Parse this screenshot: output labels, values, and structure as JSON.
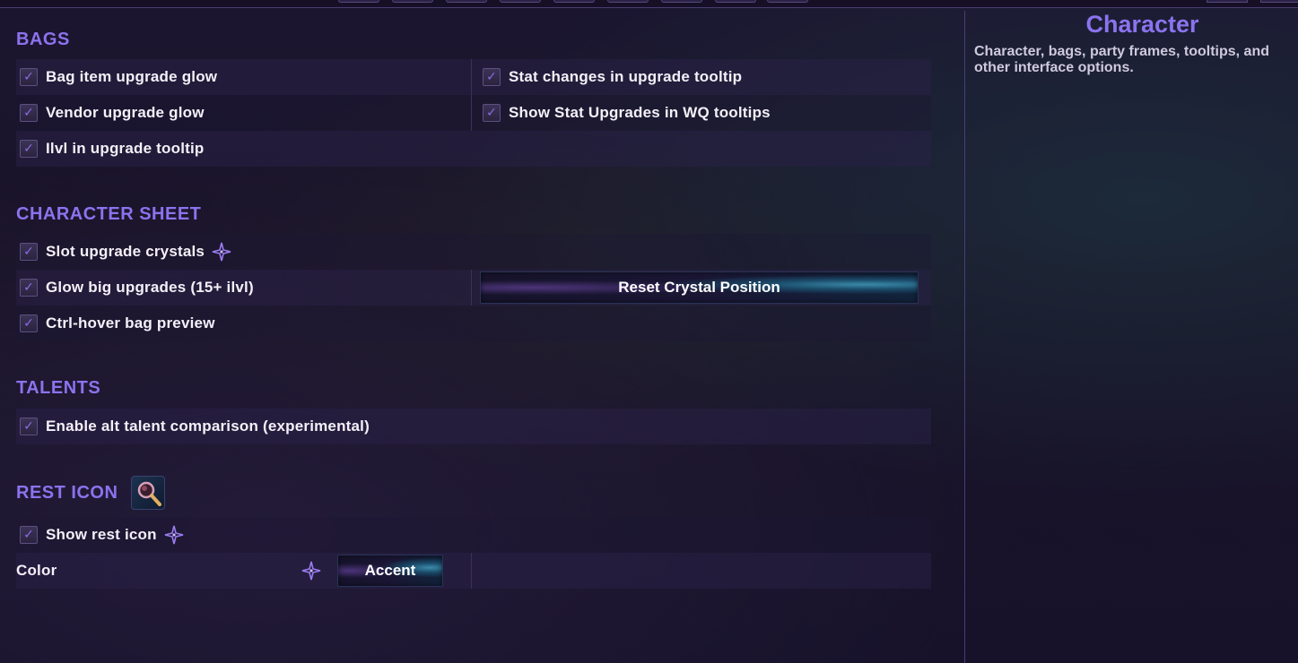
{
  "accent_color": "#8b73ee",
  "main": {
    "sections": {
      "bags": {
        "title": "BAGS",
        "items": {
          "bag_item_upgrade_glow": "Bag item upgrade glow",
          "stat_changes_upgrade_tooltip": "Stat changes in upgrade tooltip",
          "vendor_upgrade_glow": "Vendor upgrade glow",
          "show_stat_upgrades_wq": "Show Stat Upgrades in WQ tooltips",
          "ilvl_upgrade_tooltip": "Ilvl in upgrade tooltip"
        }
      },
      "character_sheet": {
        "title": "CHARACTER SHEET",
        "items": {
          "slot_upgrade_crystals": "Slot upgrade crystals",
          "glow_big_upgrades": "Glow big upgrades (15+ ilvl)",
          "ctrl_hover_bag_preview": "Ctrl-hover bag preview"
        },
        "reset_button": "Reset Crystal Position"
      },
      "talents": {
        "title": "TALENTS",
        "items": {
          "enable_alt_talent": "Enable alt talent comparison (experimental)"
        }
      },
      "rest_icon": {
        "title": "REST ICON",
        "items": {
          "show_rest_icon": "Show rest icon"
        },
        "color_label": "Color",
        "color_button": "Accent"
      }
    },
    "checkbox_mark": "✓"
  },
  "sidebar": {
    "title": "Character",
    "description": "Character, bags, party frames, tooltips, and other interface options."
  },
  "icons": [
    "checkbox-checked-icon",
    "sparkle-icon",
    "magnifier-icon"
  ]
}
